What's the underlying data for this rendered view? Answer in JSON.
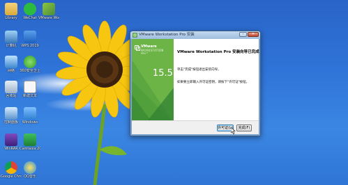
{
  "desktop": {
    "icons": [
      {
        "label": "Library",
        "icon": "library-folder-icon"
      },
      {
        "label": "WeChat",
        "icon": "wechat-icon"
      },
      {
        "label": "VMware Workstation",
        "icon": "vmware-icon"
      },
      {
        "label": "计算机",
        "icon": "computer-icon"
      },
      {
        "label": "WPS 2019",
        "icon": "wps-icon"
      },
      {
        "label": "网络",
        "icon": "network-icon"
      },
      {
        "label": "360安全卫士",
        "icon": "security-360-icon"
      },
      {
        "label": "回收站",
        "icon": "recycle-bin-icon"
      },
      {
        "label": "新建文本",
        "icon": "text-file-icon"
      },
      {
        "label": "控制面板",
        "icon": "control-panel-icon"
      },
      {
        "label": "Windows",
        "icon": "folder-icon"
      },
      {
        "label": "WinRAR",
        "icon": "winrar-icon"
      },
      {
        "label": "Camtasia 2019",
        "icon": "camtasia-icon"
      },
      {
        "label": "Google Chrome",
        "icon": "chrome-icon"
      },
      {
        "label": "QQ音乐",
        "icon": "qq-music-icon"
      }
    ]
  },
  "installer": {
    "title": "VMware Workstation Pro 安装",
    "banner": {
      "brand": "VMware",
      "product": "WORKSTATION",
      "edition": "PRO™",
      "version": "15.5"
    },
    "heading": "VMware Workstation Pro 安装向导已完成",
    "message1": "单击\"完成\"按钮退出安装向导。",
    "message2": "如果要立即输入许可证密钥，请按下\"许可证\"按钮。",
    "buttons": {
      "license": "许可证(L)",
      "finish": "完成(F)"
    },
    "colors": {
      "banner": "#6db446",
      "banner_dark": "#2e7d32"
    }
  }
}
